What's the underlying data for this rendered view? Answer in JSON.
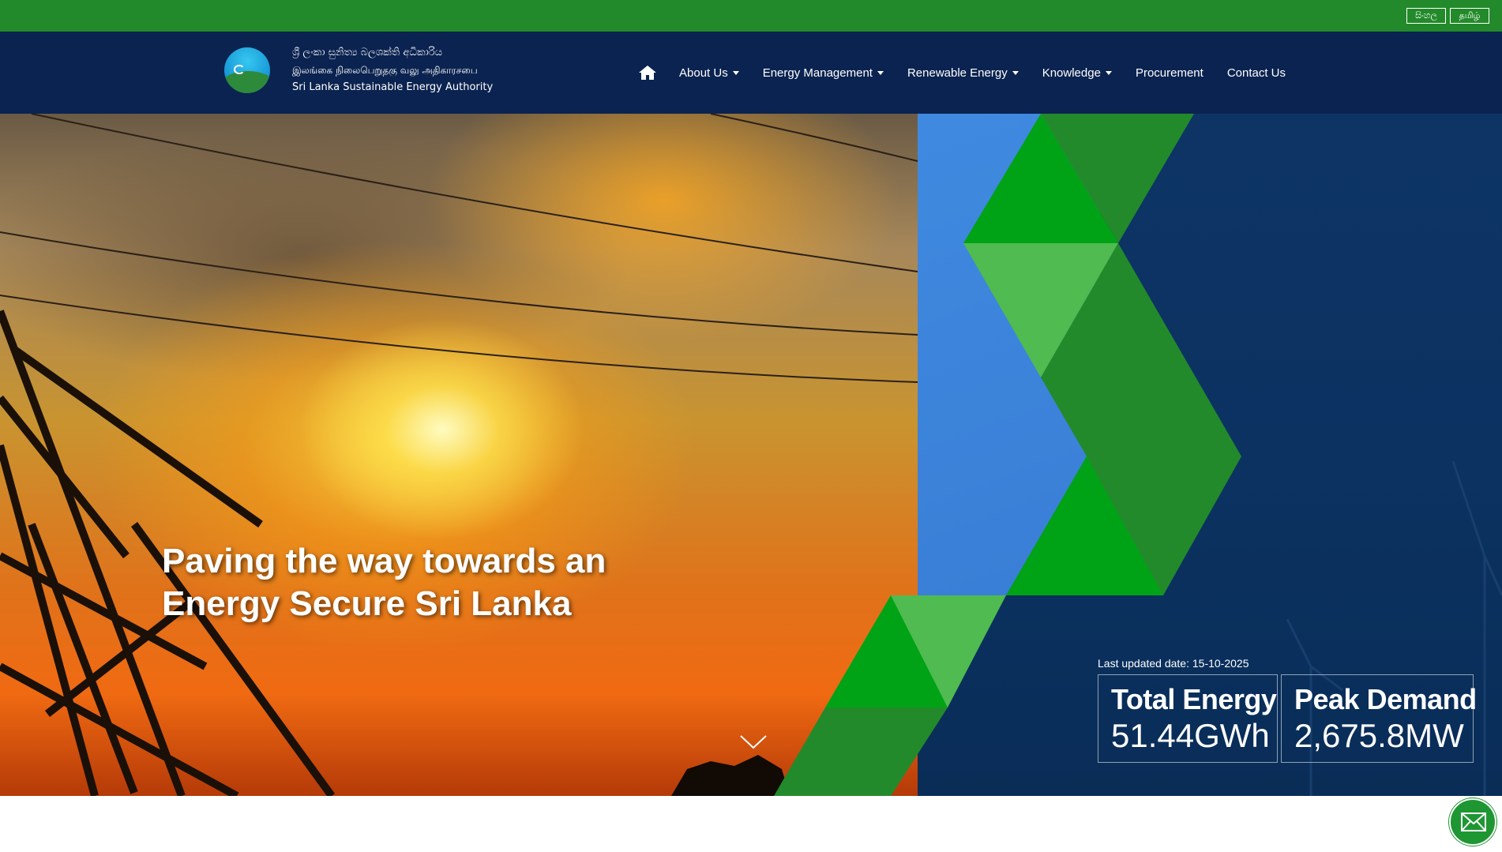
{
  "topbar": {
    "languages": [
      {
        "label": "සිංහල"
      },
      {
        "label": "தமிழ்"
      }
    ]
  },
  "header": {
    "logo_lines": {
      "sinhala": "ශ්‍රී ලංකා සුනිත්‍ය බලශක්ති අධිකාරිය",
      "tamil": "இலங்கை நிலைபெறுதகு வலு அதிகாரசபை",
      "english": "Sri Lanka Sustainable Energy Authority"
    },
    "nav": {
      "home_icon": "home-icon",
      "items": [
        {
          "label": "About Us",
          "dropdown": true
        },
        {
          "label": "Energy Management",
          "dropdown": true
        },
        {
          "label": "Renewable Energy",
          "dropdown": true
        },
        {
          "label": "Knowledge",
          "dropdown": true
        },
        {
          "label": "Procurement",
          "dropdown": false
        },
        {
          "label": "Contact Us",
          "dropdown": false
        }
      ]
    }
  },
  "hero": {
    "title_line1": "Paving the way towards an",
    "title_line2": "Energy Secure Sri Lanka",
    "scroll_icon": "chevron-down-icon"
  },
  "stats": {
    "last_updated": "Last updated date: 15-10-2025",
    "total_energy": {
      "label": "Total Energy",
      "value": "51.44GWh"
    },
    "peak_demand": {
      "label": "Peak Demand",
      "value": "2,675.8MW"
    }
  },
  "floating": {
    "mail_icon": "mail-icon"
  },
  "colors": {
    "topbar": "#238a2b",
    "navbar": "#0b2350",
    "hero_blue": "#0d3465",
    "green_bright": "#00a316",
    "green_dark": "#238a2b",
    "green_light": "#4fbb50"
  }
}
